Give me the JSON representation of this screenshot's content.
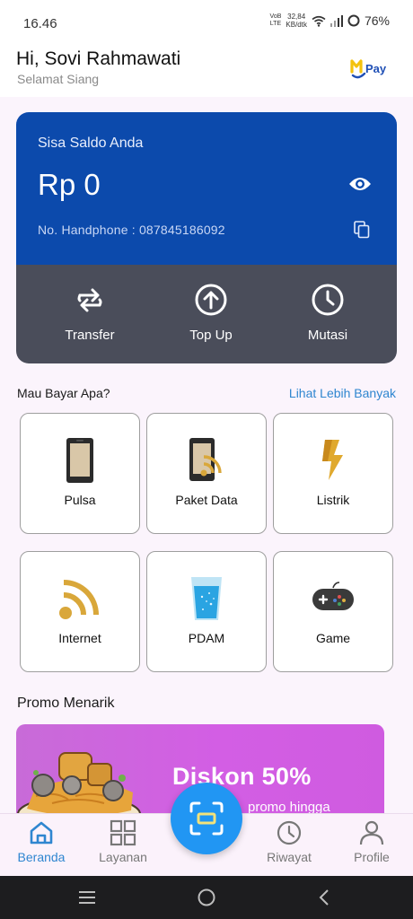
{
  "status_bar": {
    "time": "16.46",
    "volte": "VoB",
    "lte": "LTE",
    "speed_value": "32,84",
    "speed_unit": "KB/dtk",
    "battery": "76%"
  },
  "header": {
    "greeting": "Hi, Sovi Rahmawati",
    "subtitle": "Selamat Siang",
    "logo_text": "Pay"
  },
  "balance": {
    "label": "Sisa Saldo Anda",
    "amount": "Rp 0",
    "phone": "No. Handphone : 087845186092",
    "actions": [
      {
        "label": "Transfer",
        "icon": "transfer-icon"
      },
      {
        "label": "Top Up",
        "icon": "arrow-up-circle-icon"
      },
      {
        "label": "Mutasi",
        "icon": "clock-icon"
      }
    ]
  },
  "services_section": {
    "title": "Mau Bayar Apa?",
    "link": "Lihat Lebih Banyak",
    "items": [
      {
        "label": "Pulsa",
        "icon": "phone-icon"
      },
      {
        "label": "Paket Data",
        "icon": "phone-data-icon"
      },
      {
        "label": "Listrik",
        "icon": "lightning-icon"
      },
      {
        "label": "Internet",
        "icon": "wifi-icon"
      },
      {
        "label": "PDAM",
        "icon": "water-glass-icon"
      },
      {
        "label": "Game",
        "icon": "gamepad-icon"
      }
    ]
  },
  "promo": {
    "title": "Promo Menarik",
    "headline": "Diskon 50%",
    "subline": "promo hingga"
  },
  "bottom_nav": {
    "items": [
      {
        "label": "Beranda",
        "icon": "home-icon",
        "active": true
      },
      {
        "label": "Layanan",
        "icon": "grid-icon"
      },
      {
        "label": "Riwayat",
        "icon": "history-icon"
      },
      {
        "label": "Profile",
        "icon": "user-icon"
      }
    ],
    "center_button_icon": "scan-icon"
  },
  "colors": {
    "card_blue": "#0c4aac",
    "card_gray": "#4a4d5a",
    "accent": "#2f86d0",
    "fab": "#2196f3",
    "icon_gold": "#d9a73a"
  }
}
